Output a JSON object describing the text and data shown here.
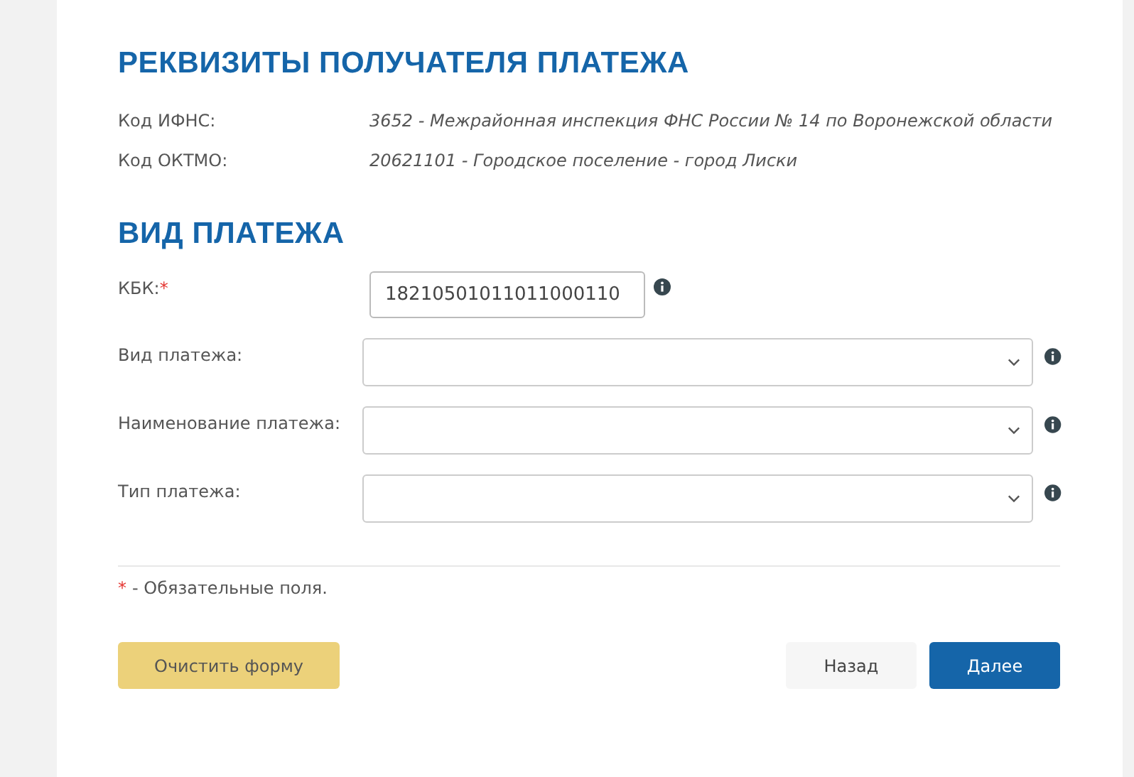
{
  "recipient": {
    "title": "РЕКВИЗИТЫ ПОЛУЧАТЕЛЯ ПЛАТЕЖА",
    "rows": [
      {
        "label": "Код ИФНС:",
        "value": "3652 - Межрайонная инспекция ФНС России № 14 по Воронежской области"
      },
      {
        "label": "Код ОКТМО:",
        "value": "20621101 - Городское поселение - город Лиски"
      }
    ]
  },
  "payment": {
    "title": "ВИД ПЛАТЕЖА",
    "fields": [
      {
        "kind": "text",
        "label": "КБК:",
        "required_mark": "*",
        "value": "18210501011011000110"
      },
      {
        "kind": "select",
        "label": "Вид платежа:"
      },
      {
        "kind": "select",
        "label": "Наименование платежа:"
      },
      {
        "kind": "select",
        "label": "Тип платежа:"
      }
    ]
  },
  "note": {
    "mark": "*",
    "text": "- Обязательные поля."
  },
  "buttons": {
    "clear": "Очистить форму",
    "back": "Назад",
    "next": "Далее"
  }
}
